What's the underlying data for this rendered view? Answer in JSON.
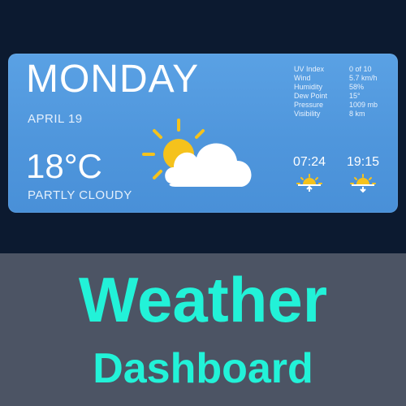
{
  "widget": {
    "day": "MONDAY",
    "date": "APRIL 19",
    "temperature": "18°C",
    "condition": "PARTLY CLOUDY",
    "weather_icon": "partly-cloudy-icon",
    "stats": [
      {
        "label": "UV Index",
        "value": "0 of 10"
      },
      {
        "label": "Wind",
        "value": "5.7 km/h"
      },
      {
        "label": "Humidity",
        "value": "58%"
      },
      {
        "label": "Dew Point",
        "value": "15°"
      },
      {
        "label": "Pressure",
        "value": "1009 mb"
      },
      {
        "label": "Visibility",
        "value": "8 km"
      }
    ],
    "sunrise": {
      "time": "07:24",
      "icon": "sunrise-icon"
    },
    "sunset": {
      "time": "19:15",
      "icon": "sunset-icon"
    }
  },
  "caption": {
    "line1": "Weather",
    "line2": "Dashboard"
  },
  "colors": {
    "widget_blue": "#5aa1e4",
    "sun_yellow": "#f5c21c",
    "caption_cyan": "#22f2d8",
    "caption_bg": "#4c5464",
    "top_bg": "#0c1a30"
  }
}
